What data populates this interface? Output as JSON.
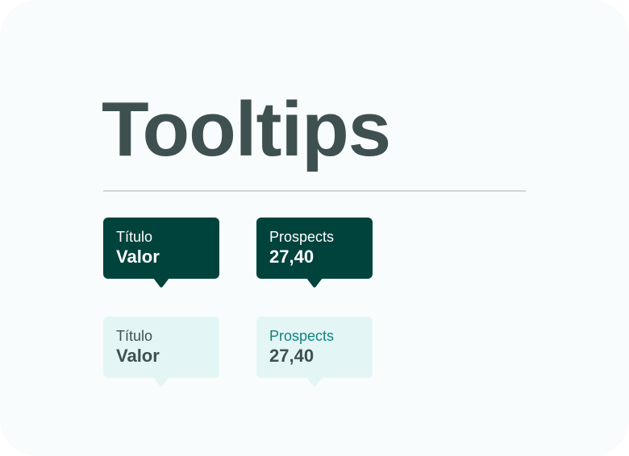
{
  "title": "Tooltips",
  "colors": {
    "dark_background": "#00433d",
    "light_background": "#e4f5f6",
    "title_text": "#3f5050",
    "accent_text": "#0e837e"
  },
  "tooltips": [
    {
      "variant": "dark",
      "label": "Título",
      "value": "Valor"
    },
    {
      "variant": "dark",
      "label": "Prospects",
      "value": "27,40"
    },
    {
      "variant": "light",
      "label": "Título",
      "value": "Valor"
    },
    {
      "variant": "light",
      "label": "Prospects",
      "value": "27,40"
    }
  ]
}
